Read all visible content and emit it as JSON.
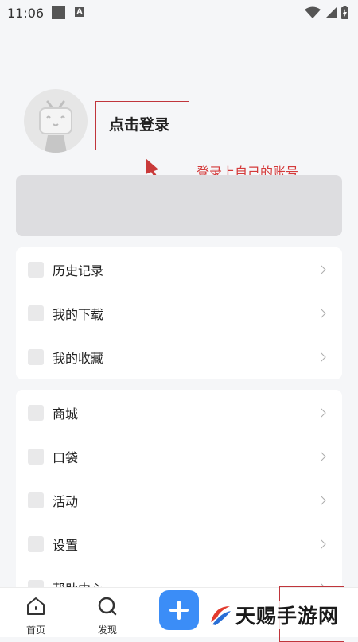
{
  "status_bar": {
    "time": "11:06",
    "a_badge": "A"
  },
  "profile": {
    "login_label": "点击登录"
  },
  "annotation": {
    "text": "登录上自己的账号",
    "color": "#d43a3a"
  },
  "menu_group_1": [
    {
      "label": "历史记录"
    },
    {
      "label": "我的下载"
    },
    {
      "label": "我的收藏"
    }
  ],
  "menu_group_2": [
    {
      "label": "商城"
    },
    {
      "label": "口袋"
    },
    {
      "label": "活动"
    },
    {
      "label": "设置"
    },
    {
      "label": "帮助中心"
    }
  ],
  "tab_bar": {
    "home_label": "首页",
    "discover_label": "发现"
  },
  "watermark": {
    "text": "天赐手游网"
  },
  "colors": {
    "accent_blue": "#3b8df7",
    "annotation_red": "#c0353b"
  }
}
